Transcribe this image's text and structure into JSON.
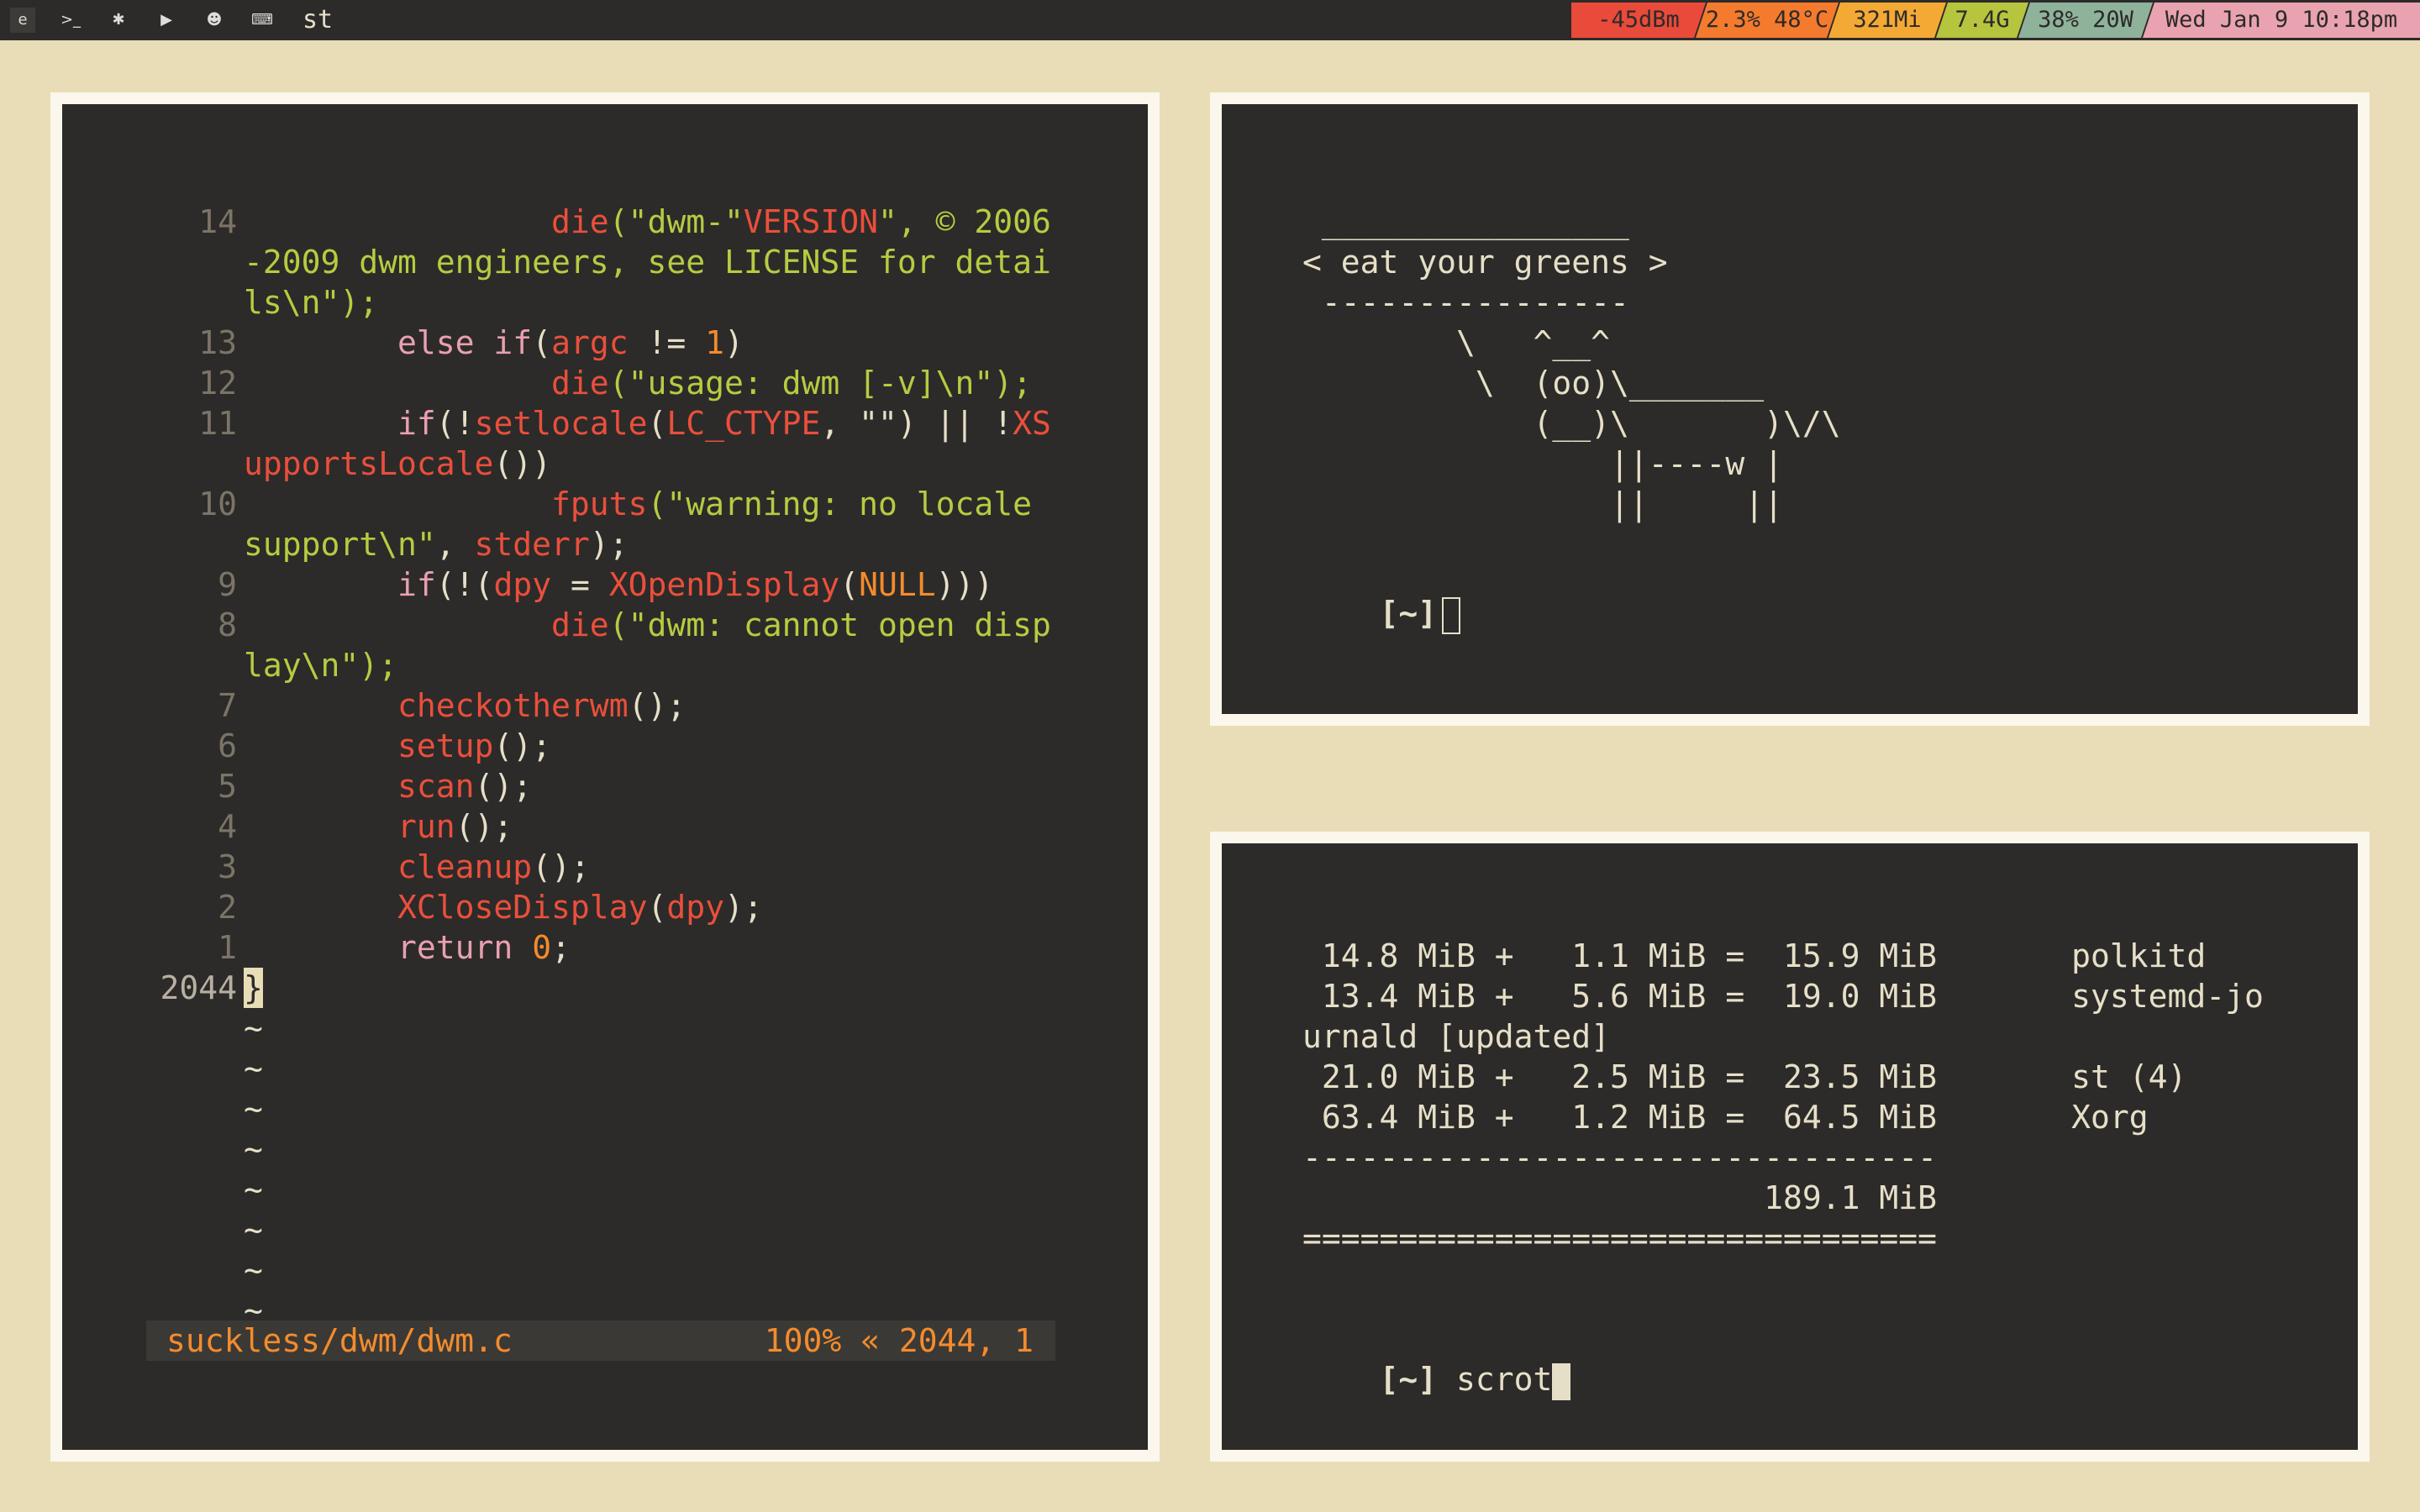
{
  "topbar": {
    "tags": [
      {
        "icon": "browser-icon",
        "glyph": "e"
      },
      {
        "icon": "terminal-icon",
        "glyph": ">_"
      },
      {
        "icon": "gear-icon",
        "glyph": "✱"
      },
      {
        "icon": "youtube-icon",
        "glyph": "▶"
      },
      {
        "icon": "chat-icon",
        "glyph": "☻"
      },
      {
        "icon": "keyboard-icon",
        "glyph": "⌨"
      }
    ],
    "window_title": "st",
    "status": [
      {
        "label": "-45dBm",
        "color": "#ea4a3a"
      },
      {
        "label": "2.3% 48°C",
        "color": "#f47a2e"
      },
      {
        "label": "321Mi",
        "color": "#f5a935"
      },
      {
        "label": "7.4G",
        "color": "#b7c43d"
      },
      {
        "label": "38% 20W",
        "color": "#8fb29a"
      },
      {
        "label": "Wed Jan 9 10:18pm",
        "color": "#e9a3b0"
      }
    ]
  },
  "editor": {
    "lines": [
      {
        "num": "14",
        "parts": [
          [
            "                ",
            ""
          ],
          [
            "die",
            "fn"
          ],
          [
            "(\"dwm-\"",
            "str"
          ],
          [
            "VERSION",
            "fn"
          ],
          [
            "\", © 2006",
            "str"
          ]
        ]
      },
      {
        "num": "",
        "parts": [
          [
            "-2009 dwm engineers, see LICENSE for detai",
            "str"
          ]
        ]
      },
      {
        "num": "",
        "parts": [
          [
            "ls\\n\");",
            "str"
          ]
        ]
      },
      {
        "num": "13",
        "parts": [
          [
            "        ",
            ""
          ],
          [
            "else if",
            "kw"
          ],
          [
            "(",
            ""
          ],
          [
            "argc",
            "fn"
          ],
          [
            " != ",
            ""
          ],
          [
            "1",
            "num"
          ],
          [
            ")",
            ""
          ]
        ]
      },
      {
        "num": "12",
        "parts": [
          [
            "                ",
            ""
          ],
          [
            "die",
            "fn"
          ],
          [
            "(\"usage: dwm [-v]\\n\");",
            "str"
          ]
        ]
      },
      {
        "num": "11",
        "parts": [
          [
            "        ",
            ""
          ],
          [
            "if",
            "kw"
          ],
          [
            "(!",
            ""
          ],
          [
            "setlocale",
            "fn"
          ],
          [
            "(",
            ""
          ],
          [
            "LC_CTYPE",
            "fn"
          ],
          [
            ", \"\") || !",
            ""
          ],
          [
            "XS",
            "fn"
          ]
        ]
      },
      {
        "num": "",
        "parts": [
          [
            "upportsLocale",
            "fn"
          ],
          [
            "())",
            ""
          ]
        ]
      },
      {
        "num": "10",
        "parts": [
          [
            "                ",
            ""
          ],
          [
            "fputs",
            "fn"
          ],
          [
            "(\"warning: no locale",
            "str"
          ]
        ]
      },
      {
        "num": "",
        "parts": [
          [
            "support\\n\"",
            "str"
          ],
          [
            ", ",
            ""
          ],
          [
            "stderr",
            "fn"
          ],
          [
            ");",
            ""
          ]
        ]
      },
      {
        "num": "9",
        "parts": [
          [
            "        ",
            ""
          ],
          [
            "if",
            "kw"
          ],
          [
            "(!(",
            ""
          ],
          [
            "dpy",
            "fn"
          ],
          [
            " = ",
            ""
          ],
          [
            "XOpenDisplay",
            "fn"
          ],
          [
            "(",
            ""
          ],
          [
            "NULL",
            "num"
          ],
          [
            ")))",
            ""
          ]
        ]
      },
      {
        "num": "8",
        "parts": [
          [
            "                ",
            ""
          ],
          [
            "die",
            "fn"
          ],
          [
            "(\"dwm: cannot open disp",
            "str"
          ]
        ]
      },
      {
        "num": "",
        "parts": [
          [
            "lay\\n\");",
            "str"
          ]
        ]
      },
      {
        "num": "7",
        "parts": [
          [
            "        ",
            ""
          ],
          [
            "checkotherwm",
            "fn"
          ],
          [
            "();",
            ""
          ]
        ]
      },
      {
        "num": "6",
        "parts": [
          [
            "        ",
            ""
          ],
          [
            "setup",
            "fn"
          ],
          [
            "();",
            ""
          ]
        ]
      },
      {
        "num": "5",
        "parts": [
          [
            "        ",
            ""
          ],
          [
            "scan",
            "fn"
          ],
          [
            "();",
            ""
          ]
        ]
      },
      {
        "num": "4",
        "parts": [
          [
            "        ",
            ""
          ],
          [
            "run",
            "fn"
          ],
          [
            "();",
            ""
          ]
        ]
      },
      {
        "num": "3",
        "parts": [
          [
            "        ",
            ""
          ],
          [
            "cleanup",
            "fn"
          ],
          [
            "();",
            ""
          ]
        ]
      },
      {
        "num": "2",
        "parts": [
          [
            "        ",
            ""
          ],
          [
            "XCloseDisplay",
            "fn"
          ],
          [
            "(",
            ""
          ],
          [
            "dpy",
            "fn"
          ],
          [
            ");",
            ""
          ]
        ]
      },
      {
        "num": "1",
        "parts": [
          [
            "        ",
            ""
          ],
          [
            "return ",
            "kw"
          ],
          [
            "0",
            "num"
          ],
          [
            ";",
            ""
          ]
        ]
      },
      {
        "num": "2044",
        "cursor": "}",
        "parts": []
      }
    ],
    "tildes": [
      "~",
      "~",
      "~",
      "~",
      "~",
      "~",
      "~",
      "~"
    ],
    "statusline": {
      "file": "suckless/dwm/dwm.c",
      "position": "100% « 2044, 1"
    }
  },
  "cowsay": {
    "art": " ________________\n< eat your greens >\n ----------------\n        \\   ^__^\n         \\  (oo)\\_______\n            (__)\\       )\\/\\\n                ||----w |\n                ||     ||",
    "prompt": "[~]"
  },
  "meminfo": {
    "rows": [
      " 14.8 MiB +   1.1 MiB =  15.9 MiB       polkitd",
      " 13.4 MiB +   5.6 MiB =  19.0 MiB       systemd-jo",
      "urnald [updated]",
      " 21.0 MiB +   2.5 MiB =  23.5 MiB       st (4)",
      " 63.4 MiB +   1.2 MiB =  64.5 MiB       Xorg",
      "---------------------------------",
      "                        189.1 MiB",
      "================================="
    ],
    "prompt": "[~]",
    "command": " scrot"
  }
}
